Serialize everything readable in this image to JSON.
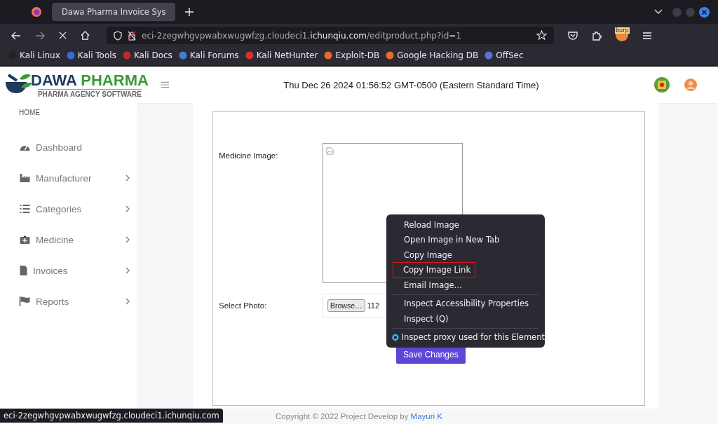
{
  "browser": {
    "tab": {
      "title": "Dawa Pharma Invoice Sys",
      "selected": true
    },
    "url": {
      "prefix": "eci-2zegwhgvpwabxwugwfzg.cloudeci1.",
      "domain": "ichunqiu.com",
      "path": "/editproduct.php?id=1"
    },
    "extension_label": "burp",
    "bookmarks": [
      {
        "label": "Kali Linux",
        "color": "#222222"
      },
      {
        "label": "Kali Tools",
        "color": "#2f6fd6"
      },
      {
        "label": "Kali Docs",
        "color": "#c0282d"
      },
      {
        "label": "Kali Forums",
        "color": "#3d7fd8"
      },
      {
        "label": "Kali NetHunter",
        "color": "#d8322f"
      },
      {
        "label": "Exploit-DB",
        "color": "#e8692a"
      },
      {
        "label": "Google Hacking DB",
        "color": "#e8692a"
      },
      {
        "label": "OffSec",
        "color": "#5a6fe0"
      }
    ]
  },
  "header": {
    "logo_word_1": "DAWA",
    "logo_word_2": "PHARMA",
    "logo_subtitle": "PHARMA AGENCY SOFTWARE",
    "datetime": "Thu Dec 26 2024 01:56:52 GMT-0500 (Eastern Standard Time)"
  },
  "sidebar": {
    "heading": "HOME",
    "items": [
      {
        "label": "Dashboard",
        "has_submenu": false
      },
      {
        "label": "Manufacturer",
        "has_submenu": true
      },
      {
        "label": "Categories",
        "has_submenu": true
      },
      {
        "label": "Medicine",
        "has_submenu": true
      },
      {
        "label": "Invoices",
        "has_submenu": true
      },
      {
        "label": "Reports",
        "has_submenu": true
      }
    ]
  },
  "form": {
    "fields": [
      {
        "kind": "image",
        "label": "Medicine Image:"
      },
      {
        "kind": "file",
        "label": "Select Photo:",
        "button": "Browse…",
        "value": "112"
      }
    ],
    "submit": "Save Changes"
  },
  "context_menu": {
    "items": [
      {
        "kind": "item",
        "label": "Reload Image",
        "highlighted": false
      },
      {
        "kind": "item",
        "label": "Open Image in New Tab",
        "highlighted": false
      },
      {
        "kind": "item",
        "label": "Copy Image",
        "highlighted": false
      },
      {
        "kind": "item",
        "label": "Copy Image Link",
        "highlighted": true
      },
      {
        "kind": "item",
        "label": "Email Image…",
        "highlighted": false
      },
      {
        "kind": "separator"
      },
      {
        "kind": "item",
        "label": "Inspect Accessibility Properties",
        "highlighted": false
      },
      {
        "kind": "item",
        "label": "Inspect (Q)",
        "highlighted": false
      },
      {
        "kind": "separator"
      },
      {
        "kind": "radio",
        "label": "Inspect proxy used for this Element",
        "checked": true
      }
    ]
  },
  "footer": {
    "text": "Copyright © 2022 Project Develop by",
    "link": "Mayuri K"
  },
  "status_bar": {
    "url": "eci-2zegwhgvpwabxwugwfzg.cloudeci1.ichunqiu.com"
  }
}
